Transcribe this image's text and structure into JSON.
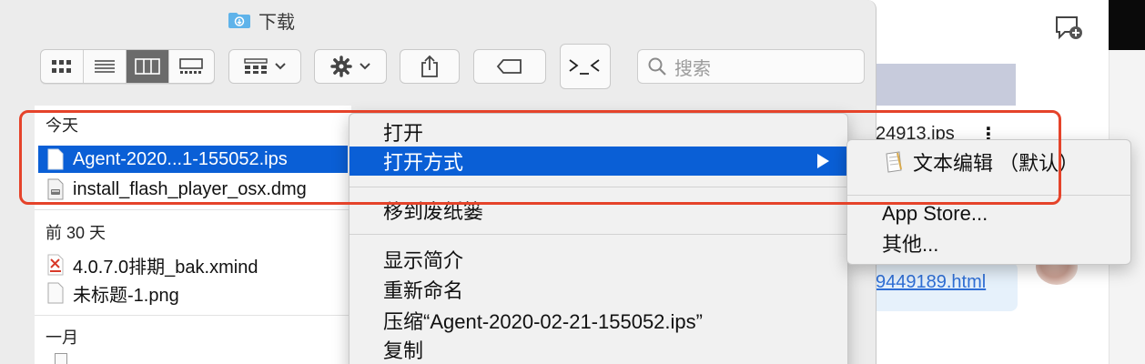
{
  "window": {
    "title": "下载"
  },
  "toolbar": {
    "view_modes": [
      "icon",
      "list",
      "column",
      "gallery"
    ],
    "active_view": "column",
    "search_placeholder": "搜索"
  },
  "sidebar_sections": [
    {
      "label": "今天",
      "files": [
        "Agent-2020...1-155052.ips",
        "install_flash_player_osx.dmg"
      ]
    },
    {
      "label": "前 30 天",
      "files": [
        "4.0.7.0排期_bak.xmind",
        "未标题-1.png"
      ]
    },
    {
      "label": "一月",
      "files": []
    }
  ],
  "selected_file": "Agent-2020...1-155052.ips",
  "context_menu": {
    "items": [
      {
        "label": "打开"
      },
      {
        "label": "打开方式",
        "highlighted": true
      },
      {
        "label": "移到废纸篓"
      },
      {
        "label": "显示简介"
      },
      {
        "label": "重新命名"
      },
      {
        "label": "压缩“Agent-2020-02-21-155052.ips”"
      },
      {
        "label": "复制"
      }
    ]
  },
  "submenu": {
    "default_app": "文本编辑 （默认）",
    "items": [
      "App Store...",
      "其他..."
    ]
  },
  "background_app": {
    "file_fragment": "24913.ips",
    "link_fragment": "9449189.html"
  },
  "colors": {
    "selection": "#0a5fd6",
    "annotation": "#e5432a"
  }
}
